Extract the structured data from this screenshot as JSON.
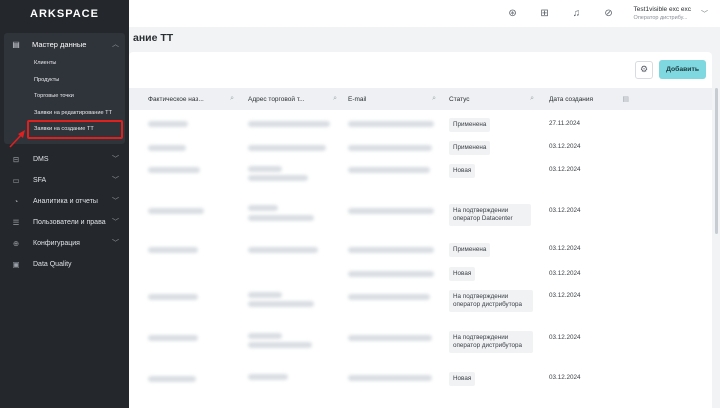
{
  "logo": "ARKSPACE",
  "sidebar": {
    "group": {
      "label": "Мастер данные",
      "items": [
        "Клиенты",
        "Продукты",
        "Торговые точки",
        "Заявки на редактирование ТТ",
        "Заявки на создание ТТ"
      ]
    },
    "items": [
      "DMS",
      "SFA",
      "Аналитика и отчеты",
      "Пользователи и права",
      "Конфигурация",
      "Data Quality"
    ]
  },
  "topbar": {
    "user_name": "Test1visible exc exc",
    "user_role": "Оператор дистрибу..."
  },
  "page_title": "ание ТТ",
  "toolbar": {
    "add_label": "Добавить"
  },
  "table": {
    "headers": [
      "Фактическое наз...",
      "Адрес торговой т...",
      "E-mail",
      "Статус",
      "Дата создания"
    ],
    "rows": [
      {
        "status": "Применена",
        "date": "27.11.2024"
      },
      {
        "status": "Применена",
        "date": "03.12.2024"
      },
      {
        "status": "Новая",
        "date": "03.12.2024"
      },
      {
        "status": "На подтверждении оператор Datacenter",
        "date": "03.12.2024"
      },
      {
        "status": "Применена",
        "date": "03.12.2024"
      },
      {
        "status": "Новая",
        "date": "03.12.2024"
      },
      {
        "status": "На подтверждении оператор дистрибутора",
        "date": "03.12.2024"
      },
      {
        "status": "На подтверждении оператор дистрибутора",
        "date": "03.12.2024"
      },
      {
        "status": "Новая",
        "date": "03.12.2024"
      }
    ]
  }
}
